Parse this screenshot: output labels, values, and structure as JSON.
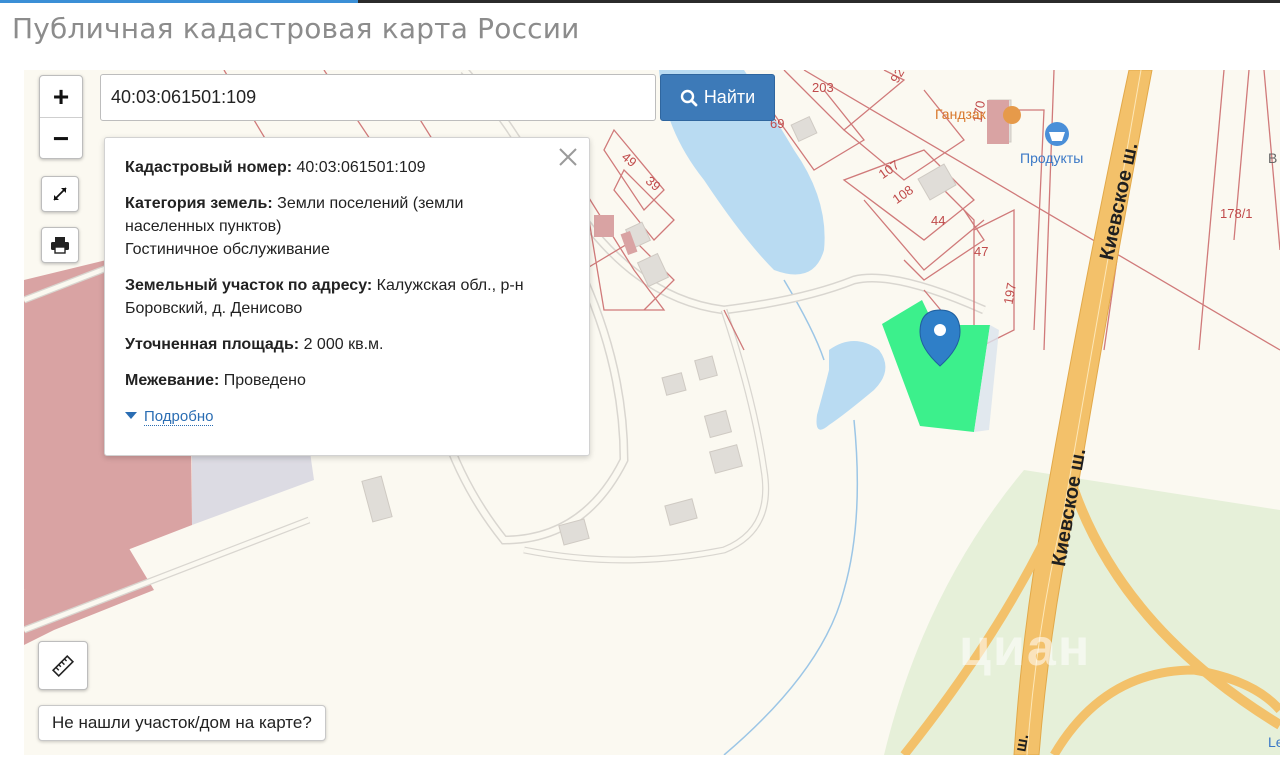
{
  "header": {
    "title": "Публичная кадастровая карта России"
  },
  "search": {
    "value": "40:03:061501:109",
    "button_label": "Найти"
  },
  "zoom": {
    "in_label": "+",
    "out_label": "−"
  },
  "popup": {
    "cadastral_label": "Кадастровый номер:",
    "cadastral_value": "40:03:061501:109",
    "category_label": "Категория земель:",
    "category_value": "Земли поселений (земли населенных пунктов)",
    "category_use": "Гостиничное обслуживание",
    "address_label": "Земельный участок по адресу:",
    "address_value": "Калужская обл., р-н Боровский, д. Денисово",
    "area_label": "Уточненная площадь:",
    "area_value": "2 000 кв.м.",
    "survey_label": "Межевание:",
    "survey_value": "Проведено",
    "details_label": "Подробно"
  },
  "map": {
    "plot_numbers": [
      "203",
      "92",
      "170",
      "69",
      "49",
      "39",
      "107",
      "108",
      "44",
      "47",
      "197",
      "178/1"
    ],
    "road_label_1": "Киевское ш.",
    "road_label_2": "Киевское ш.",
    "poi_gandzak": "Гандзак",
    "poi_products": "Продукты",
    "edge_letter_1": "В",
    "edge_letter_2": "Le",
    "edge_letter_3": "ш.",
    "watermark": "циан"
  },
  "footer": {
    "not_found_label": "Не нашли участок/дом на карте?"
  },
  "colors": {
    "accent": "#3b8fd6",
    "button": "#3d7ab8",
    "selected_plot": "#3cf08c",
    "marker": "#2f7fc8",
    "highway": "#f3c16a",
    "water": "#b9dbf2",
    "industrial": "#d9a3a3"
  }
}
